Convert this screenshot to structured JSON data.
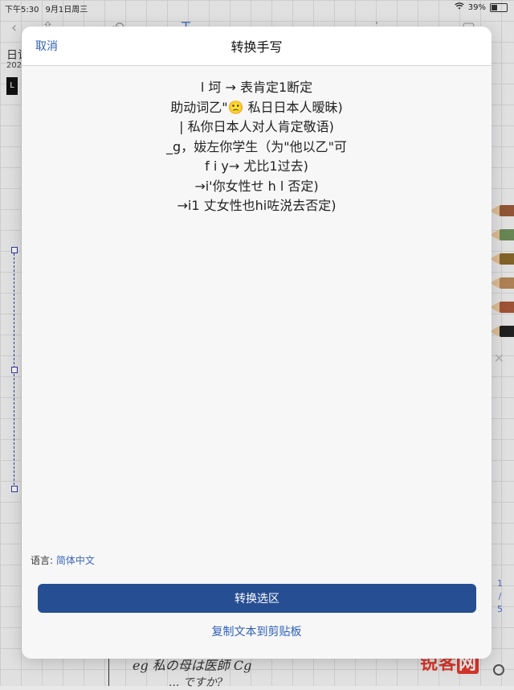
{
  "status_bar": {
    "time": "下午5:30",
    "date": "9月1日周三",
    "battery": "39%"
  },
  "background_app": {
    "title": "日记",
    "year": "202",
    "block_label": "L",
    "page_indicator": [
      "1",
      "/",
      "5"
    ],
    "handwriting_line1": "eg 私の母は医師 Cg",
    "handwriting_line2": "... ですか?"
  },
  "modal": {
    "cancel_label": "取消",
    "title": "转换手写",
    "result_lines": [
      "l 坷 → 表肯定1断定",
      "助动词乙\"🙁 私日日本人暧昧)",
      "| 私你日本人对人肯定敬语)",
      "_g，妭左你学生（为\"他以乙\"可",
      "f i y→ 尤比1过去)",
      "→i'你女性せ h l 否定)",
      "→i1 丈女性也hi咗涚去否定)"
    ],
    "language_label": "语言:",
    "language_value": "简体中文",
    "convert_button": "转换选区",
    "copy_link": "复制文本到剪贴板"
  },
  "watermark": {
    "brand": "锐客",
    "suffix": "网"
  },
  "colors": {
    "accent": "#2f60b8",
    "primary_button": "#264e93",
    "watermark": "#e23b2e"
  }
}
